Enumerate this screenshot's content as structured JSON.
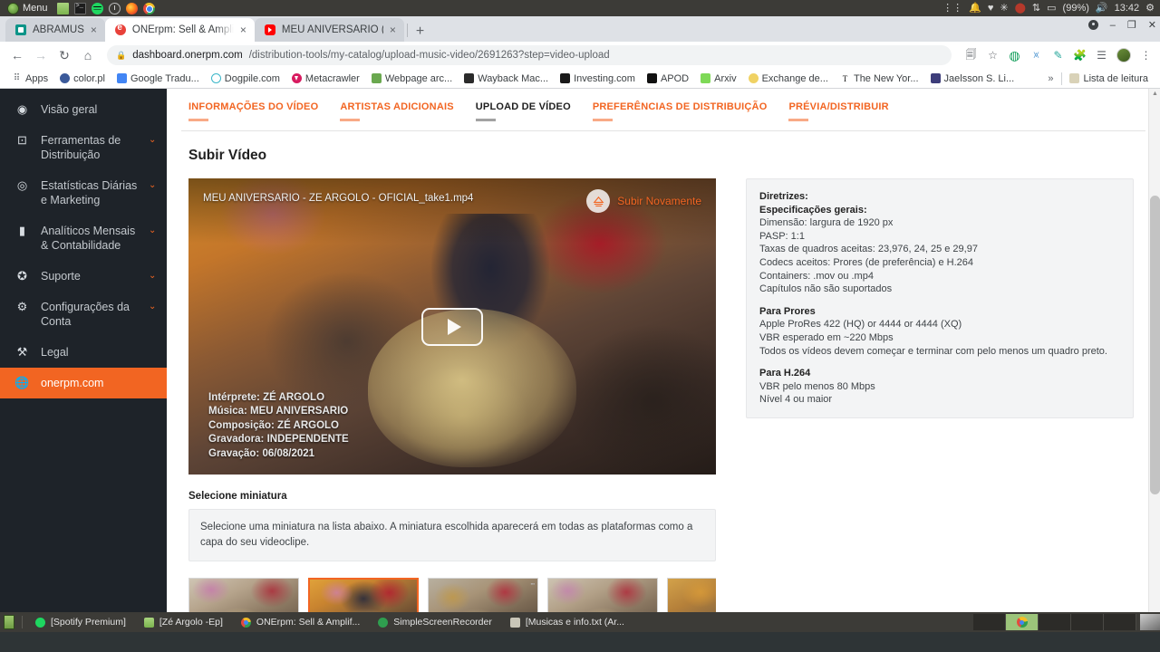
{
  "os": {
    "menu_label": "Menu",
    "launchers": [
      "menu-icon",
      "file-manager-icon",
      "terminal-icon",
      "spotify-icon",
      "clock-icon",
      "firefox-icon",
      "chrome-icon"
    ],
    "tray": {
      "battery": "(99%)",
      "time": "13:42",
      "icons": [
        "bell-icon",
        "heart-icon",
        "bluetooth-icon",
        "dropbox-icon",
        "network-icon",
        "display-icon",
        "volume-icon",
        "settings-icon"
      ]
    }
  },
  "browser": {
    "tabs": [
      {
        "title": "ABRAMUS",
        "favicon": "abramus-icon",
        "active": false
      },
      {
        "title": "ONErpm: Sell & Amplify",
        "favicon": "onerpm-icon",
        "active": true
      },
      {
        "title": "MEU ANIVERSARIO (TA",
        "favicon": "youtube-icon",
        "active": false
      }
    ],
    "new_tab_label": "+",
    "close_label": "×",
    "window_controls": {
      "minimize": "–",
      "maximize": "❐",
      "close": "✕"
    },
    "nav": {
      "back": "←",
      "forward": "→",
      "reload": "↻",
      "home": "⌂"
    },
    "omnibox": {
      "lock": "🔒",
      "url_host": "dashboard.onerpm.com",
      "url_path": "/distribution-tools/my-catalog/upload-music-video/2691263?step=video-upload"
    },
    "toolbar_icons": [
      "translate-icon",
      "bookmark-star-icon",
      "green-circle-extension-icon",
      "blue-extension-icon",
      "teal-extension-icon",
      "puzzle-extension-icon",
      "playlist-icon",
      "profile-avatar",
      "kebab-menu-icon"
    ],
    "bookmarks": [
      {
        "label": "Apps",
        "icon": "apps-grid-icon"
      },
      {
        "label": "color.pl",
        "icon": "colorpl-icon"
      },
      {
        "label": "Google Tradu...",
        "icon": "google-translate-icon"
      },
      {
        "label": "Dogpile.com",
        "icon": "dogpile-icon"
      },
      {
        "label": "Metacrawler",
        "icon": "metacrawler-icon"
      },
      {
        "label": "Webpage arc...",
        "icon": "webpage-archive-icon"
      },
      {
        "label": "Wayback Mac...",
        "icon": "wayback-icon"
      },
      {
        "label": "Investing.com",
        "icon": "investing-icon"
      },
      {
        "label": "APOD",
        "icon": "apod-icon"
      },
      {
        "label": "Arxiv",
        "icon": "arxiv-icon"
      },
      {
        "label": "Exchange de...",
        "icon": "exchange-icon"
      },
      {
        "label": "The New Yor...",
        "icon": "nyt-icon"
      },
      {
        "label": "Jaelsson S. Li...",
        "icon": "jaelsson-icon"
      }
    ],
    "bookmarks_overflow": "»",
    "reading_list": {
      "label": "Lista de leitura",
      "icon": "reading-list-icon"
    }
  },
  "sidebar": {
    "items": [
      {
        "label": "Visão geral",
        "icon": "dashboard-icon",
        "caret": false,
        "active": false
      },
      {
        "label": "Ferramentas de Distribuição",
        "icon": "distribution-icon",
        "caret": true,
        "active": false
      },
      {
        "label": "Estatísticas Diárias e Marketing",
        "icon": "stats-icon",
        "caret": true,
        "active": false
      },
      {
        "label": "Analíticos Mensais & Contabilidade",
        "icon": "analytics-icon",
        "caret": true,
        "active": false
      },
      {
        "label": "Suporte",
        "icon": "support-icon",
        "caret": true,
        "active": false
      },
      {
        "label": "Configurações da Conta",
        "icon": "gear-icon",
        "caret": true,
        "active": false
      },
      {
        "label": "Legal",
        "icon": "gavel-icon",
        "caret": false,
        "active": false
      },
      {
        "label": "onerpm.com",
        "icon": "globe-icon",
        "caret": false,
        "active": true
      }
    ],
    "accent_color": "#f26522",
    "background_color": "#1e2329"
  },
  "steps": [
    {
      "label": "INFORMAÇÕES DO VÍDEO",
      "active": false
    },
    {
      "label": "ARTISTAS ADICIONAIS",
      "active": false
    },
    {
      "label": "UPLOAD DE VÍDEO",
      "active": true
    },
    {
      "label": "PREFERÊNCIAS DE DISTRIBUIÇÃO",
      "active": false
    },
    {
      "label": "PRÉVIA/DISTRIBUIR",
      "active": false
    }
  ],
  "main": {
    "page_title": "Subir Vídeo",
    "player": {
      "filename": "MEU ANIVERSARIO - ZE ARGOLO - OFICIAL_take1.mp4",
      "reupload_label": "Subir Novamente",
      "reupload_icon": "upload-icon",
      "play_icon": "play-icon",
      "credits": [
        {
          "label": "Intérprete:",
          "value": "ZÉ ARGOLO"
        },
        {
          "label": "Música:",
          "value": "MEU ANIVERSARIO"
        },
        {
          "label": "Composição:",
          "value": "ZÉ ARGOLO"
        },
        {
          "label": "Gravadora:",
          "value": "INDEPENDENTE"
        },
        {
          "label": "Gravação:",
          "value": "06/08/2021"
        }
      ]
    },
    "thumbnails": {
      "title": "Selecione miniatura",
      "note": "Selecione uma miniatura na lista abaixo. A miniatura escolhida aparecerá em todas as plataformas como a capa do seu videoclipe.",
      "items": [
        {
          "selected": false
        },
        {
          "selected": true
        },
        {
          "selected": false
        },
        {
          "selected": false
        },
        {
          "selected": false
        }
      ],
      "scroll_left": "◂",
      "scroll_right": "▸"
    }
  },
  "guidelines": {
    "heading": "Diretrizes:",
    "general_heading": "Especificações gerais:",
    "general": [
      "Dimensão: largura de 1920 px",
      "PASP: 1:1",
      "Taxas de quadros aceitas: 23,976, 24, 25 e 29,97",
      "Codecs aceitos: Prores (de preferência) e H.264",
      "Containers: .mov ou .mp4",
      "Capítulos não são suportados"
    ],
    "prores_heading": "Para Prores",
    "prores": [
      "Apple ProRes 422 (HQ) or 4444 or 4444 (XQ)",
      "VBR esperado em ~220 Mbps",
      "Todos os vídeos devem começar e terminar com pelo menos um quadro preto."
    ],
    "h264_heading": "Para H.264",
    "h264": [
      "VBR pelo menos 80 Mbps",
      "Nível 4 ou maior"
    ]
  },
  "taskbar": {
    "items": [
      {
        "label": "[Spotify Premium]",
        "icon": "spotify-icon"
      },
      {
        "label": "[Zé Argolo -Ep]",
        "icon": "folder-icon"
      },
      {
        "label": "ONErpm: Sell & Amplif...",
        "icon": "chrome-icon"
      },
      {
        "label": "SimpleScreenRecorder",
        "icon": "recorder-icon"
      },
      {
        "label": "[Musicas e info.txt (Ar...",
        "icon": "text-file-icon"
      }
    ],
    "workspaces": [
      {
        "active": false
      },
      {
        "active": true
      },
      {
        "active": false
      },
      {
        "active": false
      },
      {
        "active": false
      }
    ]
  }
}
